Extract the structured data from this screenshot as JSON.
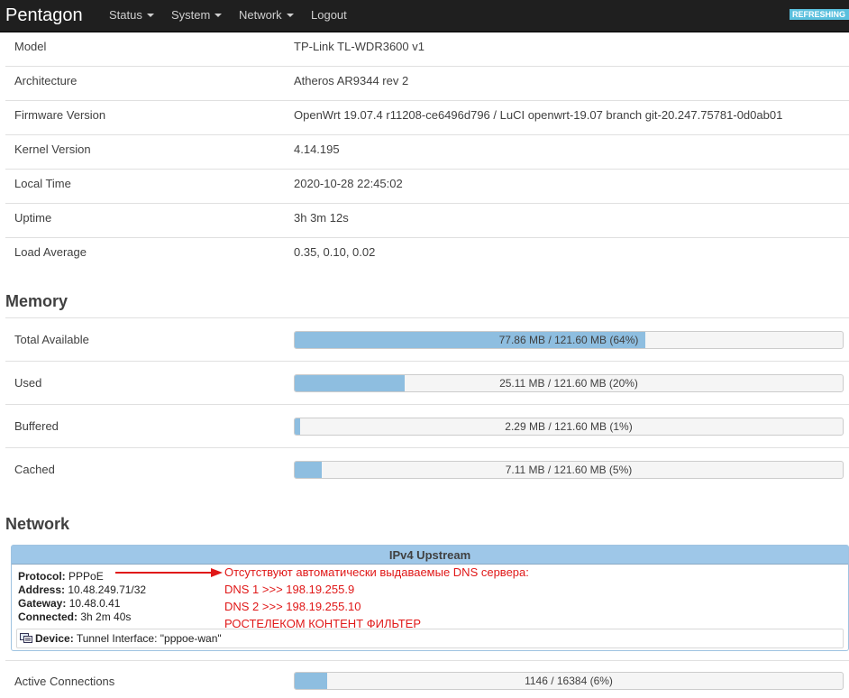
{
  "navbar": {
    "brand": "Pentagon",
    "menu": [
      {
        "label": "Status"
      },
      {
        "label": "System"
      },
      {
        "label": "Network"
      },
      {
        "label": "Logout"
      }
    ],
    "badge": "REFRESHING"
  },
  "system": {
    "rows": [
      {
        "key": "Model",
        "value": "TP-Link TL-WDR3600 v1"
      },
      {
        "key": "Architecture",
        "value": "Atheros AR9344 rev 2"
      },
      {
        "key": "Firmware Version",
        "value": "OpenWrt 19.07.4 r11208-ce6496d796 / LuCI openwrt-19.07 branch git-20.247.75781-0d0ab01"
      },
      {
        "key": "Kernel Version",
        "value": "4.14.195"
      },
      {
        "key": "Local Time",
        "value": "2020-10-28 22:45:02"
      },
      {
        "key": "Uptime",
        "value": "3h 3m 12s"
      },
      {
        "key": "Load Average",
        "value": "0.35, 0.10, 0.02"
      }
    ]
  },
  "memory": {
    "title": "Memory",
    "rows": [
      {
        "key": "Total Available",
        "text": "77.86 MB / 121.60 MB (64%)",
        "percent": 64
      },
      {
        "key": "Used",
        "text": "25.11 MB / 121.60 MB (20%)",
        "percent": 20
      },
      {
        "key": "Buffered",
        "text": "2.29 MB / 121.60 MB (1%)",
        "percent": 1
      },
      {
        "key": "Cached",
        "text": "7.11 MB / 121.60 MB (5%)",
        "percent": 5
      }
    ]
  },
  "network": {
    "title": "Network",
    "upstream": {
      "title": "IPv4 Upstream",
      "protocol_label": "Protocol:",
      "protocol": "PPPoE",
      "address_label": "Address:",
      "address": "10.48.249.71/32",
      "gateway_label": "Gateway:",
      "gateway": "10.48.0.41",
      "connected_label": "Connected:",
      "connected": "3h 2m 40s",
      "device_label": "Device:",
      "device": "Tunnel Interface: \"pppoe-wan\""
    },
    "annotation": [
      "Отсутствуют автоматически выдаваемые DNS сервера:",
      "DNS 1 >>> 198.19.255.9",
      "DNS 2 >>> 198.19.255.10",
      "РОСТЕЛЕКОМ КОНТЕНТ ФИЛЬТЕР"
    ],
    "annotation_color": "#e01818",
    "active_connections": {
      "key": "Active Connections",
      "text": "1146 / 16384 (6%)",
      "percent": 6
    }
  },
  "colors": {
    "bar_fill": "#8ebee0",
    "badge": "#5bc0de",
    "navbar": "#1f1f1f"
  }
}
